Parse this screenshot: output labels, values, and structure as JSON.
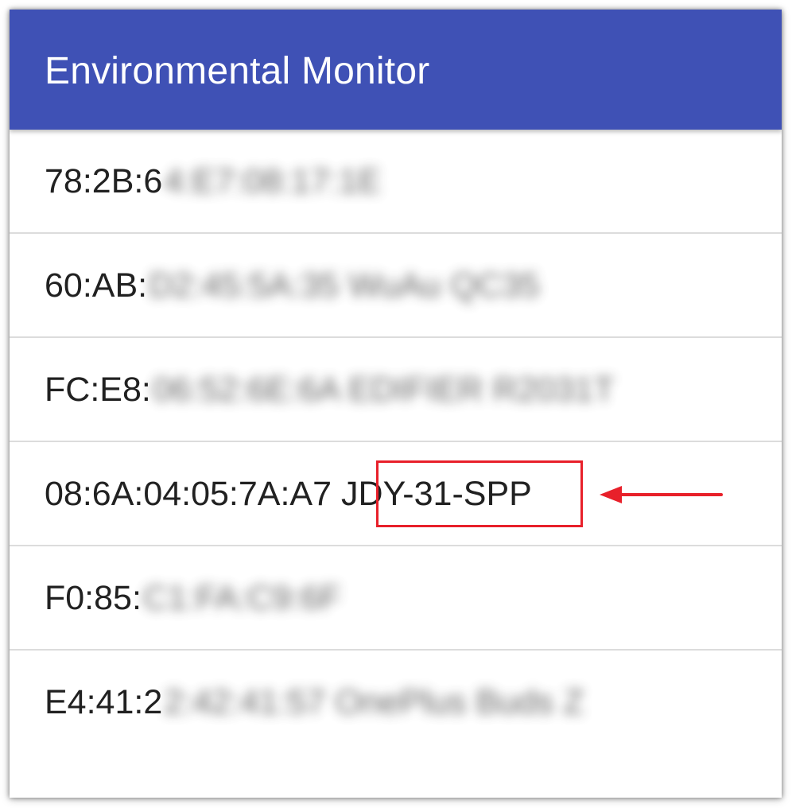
{
  "app_title": "Environmental Monitor",
  "colors": {
    "app_bar": "#3F51B5",
    "highlight": "#E8202A",
    "divider": "#DCDCDC",
    "text": "#212121"
  },
  "devices": [
    {
      "mac": "78:2B:6",
      "rest": "4:E7:08:17:1E",
      "blurred": true
    },
    {
      "mac": "60:AB:",
      "rest": "D2:45:5A:35 WuAu QC35",
      "blurred": true
    },
    {
      "mac": "FC:E8:",
      "rest": "06:52:6E:6A EDIFIER R2031T",
      "blurred": true
    },
    {
      "mac": "08:6A:04:05:7A:A7",
      "name": "JDY-31-SPP",
      "highlighted": true
    },
    {
      "mac": "F0:85:",
      "rest": "C1:FA:C9:6F",
      "blurred": true
    },
    {
      "mac": "E4:41:2",
      "rest": "2:42:41:57 OnePlus Buds Z",
      "blurred": true
    }
  ],
  "annotation": {
    "target_device": "JDY-31-SPP",
    "arrow_color": "#E8202A"
  }
}
